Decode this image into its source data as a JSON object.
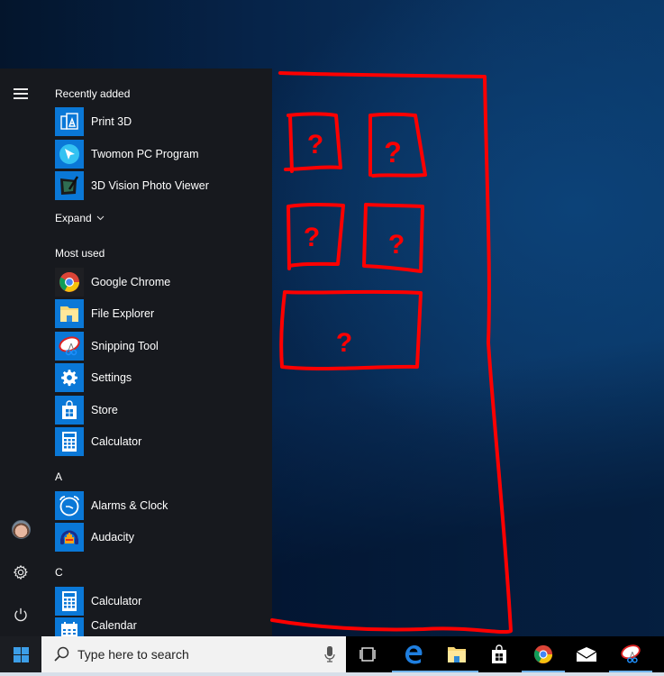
{
  "desktop": {
    "wallpaper_colors": [
      "#04152c",
      "#0a3868"
    ]
  },
  "start_menu": {
    "rail": {
      "menu_icon": "hamburger-icon",
      "user_icon": "user-avatar",
      "settings_icon": "gear-icon",
      "power_icon": "power-icon"
    },
    "recently_added": {
      "header": "Recently added",
      "items": [
        {
          "label": "Print 3D",
          "icon": "print-3d-icon"
        },
        {
          "label": "Twomon PC Program",
          "icon": "twomon-icon"
        },
        {
          "label": "3D Vision Photo Viewer",
          "icon": "3d-vision-icon"
        }
      ],
      "expand_label": "Expand"
    },
    "most_used": {
      "header": "Most used",
      "items": [
        {
          "label": "Google Chrome",
          "icon": "chrome-icon"
        },
        {
          "label": "File Explorer",
          "icon": "file-explorer-icon"
        },
        {
          "label": "Snipping Tool",
          "icon": "snipping-tool-icon"
        },
        {
          "label": "Settings",
          "icon": "gear-icon"
        },
        {
          "label": "Store",
          "icon": "store-icon"
        },
        {
          "label": "Calculator",
          "icon": "calculator-icon"
        }
      ]
    },
    "alpha_groups": [
      {
        "letter": "A",
        "items": [
          {
            "label": "Alarms & Clock",
            "icon": "alarm-clock-icon"
          },
          {
            "label": "Audacity",
            "icon": "audacity-icon"
          }
        ]
      },
      {
        "letter": "C",
        "items": [
          {
            "label": "Calculator",
            "icon": "calculator-icon"
          },
          {
            "label": "Calendar",
            "icon": "calendar-icon"
          }
        ]
      }
    ]
  },
  "annotation": {
    "color": "#ff0000",
    "tile_placeholders": [
      "?",
      "?",
      "?",
      "?",
      "?"
    ]
  },
  "taskbar": {
    "search_placeholder": "Type here to search",
    "pinned": [
      {
        "name": "Task View",
        "icon": "task-view-icon",
        "running": false
      },
      {
        "name": "Microsoft Edge",
        "icon": "edge-icon",
        "running": true
      },
      {
        "name": "File Explorer",
        "icon": "file-explorer-icon",
        "running": true
      },
      {
        "name": "Store",
        "icon": "store-icon",
        "running": false
      },
      {
        "name": "Google Chrome",
        "icon": "chrome-icon",
        "running": true
      },
      {
        "name": "Mail",
        "icon": "mail-icon",
        "running": false
      },
      {
        "name": "Snipping Tool",
        "icon": "snipping-tool-icon",
        "running": true
      }
    ]
  }
}
